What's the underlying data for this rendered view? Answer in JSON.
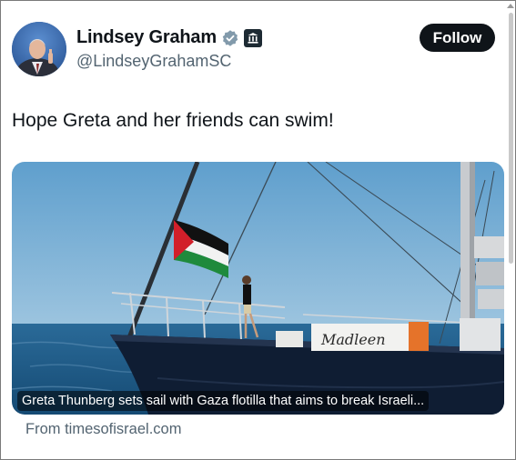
{
  "author": {
    "name": "Lindsey Graham",
    "handle": "@LindseyGrahamSC",
    "verified_icon": "verified-badge-icon",
    "affiliation_icon": "government-building-icon"
  },
  "actions": {
    "follow_label": "Follow"
  },
  "tweet": {
    "text": "Hope Greta and her friends can swim!"
  },
  "link_card": {
    "headline": "Greta Thunberg sets sail with Gaza flotilla that aims to break Israeli...",
    "source": "From timesofisrael.com",
    "boat_name": "Madleen"
  },
  "colors": {
    "accent": "#0f1419",
    "verified": "#829aab",
    "secondary_text": "#536471",
    "sky": "#6fa8cf",
    "sea": "#1d5a87"
  }
}
